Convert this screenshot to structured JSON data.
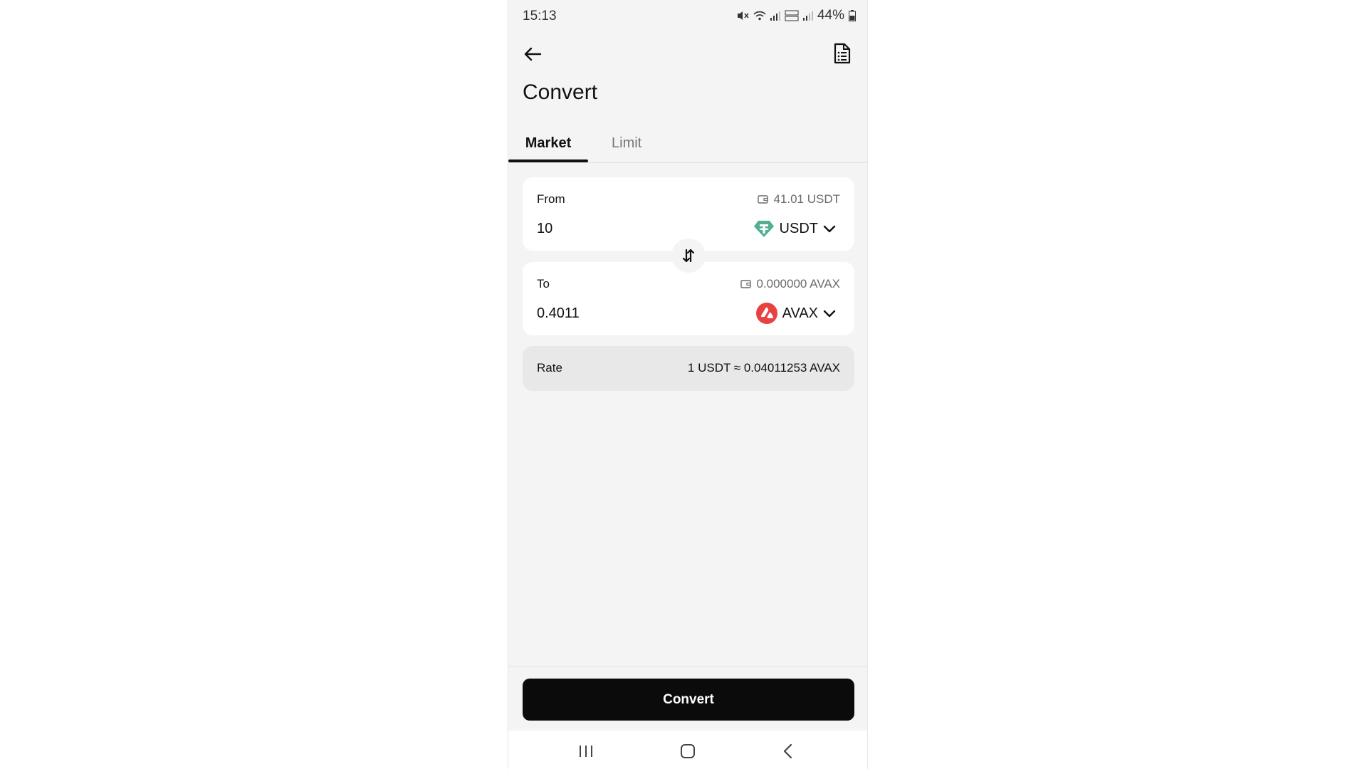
{
  "status_bar": {
    "time": "15:13",
    "battery": "44%"
  },
  "header": {
    "title": "Convert",
    "back_icon": "arrow-left-icon",
    "orders_icon": "document-list-icon"
  },
  "tabs": [
    {
      "label": "Market",
      "active": true
    },
    {
      "label": "Limit",
      "active": false
    }
  ],
  "from": {
    "label": "From",
    "balance": "41.01 USDT",
    "amount": "10",
    "token": "USDT",
    "token_color": "#50af95"
  },
  "to": {
    "label": "To",
    "balance": "0.000000 AVAX",
    "amount": "0.4011",
    "token": "AVAX",
    "token_color": "#e84142"
  },
  "rate": {
    "label": "Rate",
    "value": "1 USDT ≈ 0.04011253 AVAX"
  },
  "convert_button": {
    "label": "Convert"
  },
  "colors": {
    "page_background": "#f4f4f4",
    "primary_button": "#0b0b0b",
    "muted_text": "#6b6b6b"
  }
}
